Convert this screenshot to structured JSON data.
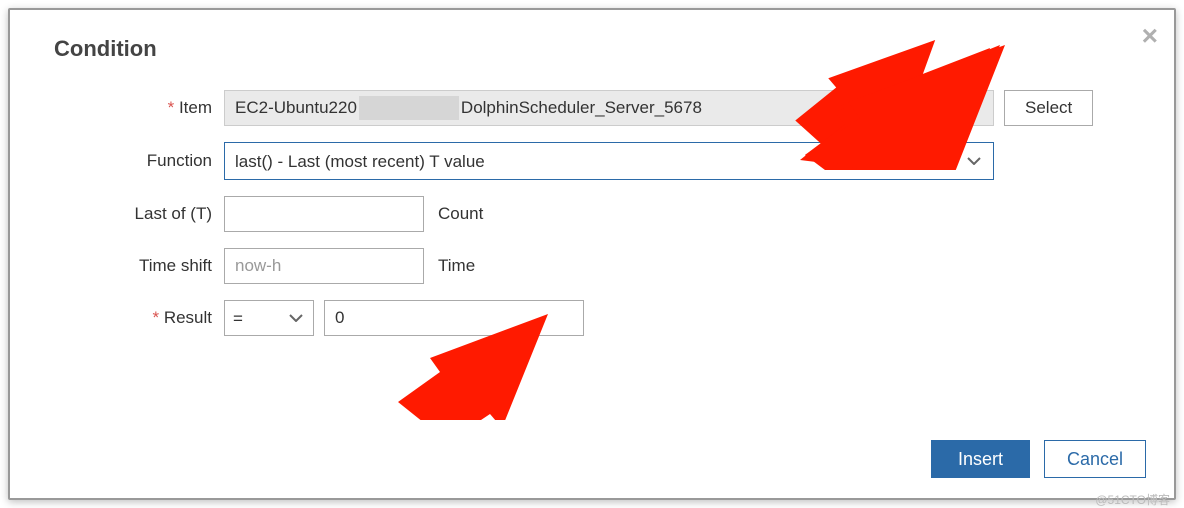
{
  "dialog": {
    "title": "Condition",
    "labels": {
      "item": "Item",
      "function": "Function",
      "last_of": "Last of (T)",
      "time_shift": "Time shift",
      "result": "Result"
    },
    "item": {
      "value_prefix": "EC2-Ubuntu220",
      "value_suffix": "DolphinScheduler_Server_5678",
      "select_button": "Select"
    },
    "function": {
      "selected": "last() - Last (most recent) T value"
    },
    "last_of": {
      "value": "",
      "suffix": "Count"
    },
    "time_shift": {
      "value": "",
      "placeholder": "now-h",
      "suffix": "Time"
    },
    "result": {
      "operator": "=",
      "value": "0"
    },
    "footer": {
      "insert": "Insert",
      "cancel": "Cancel"
    }
  },
  "watermark": "@51CTO博客"
}
